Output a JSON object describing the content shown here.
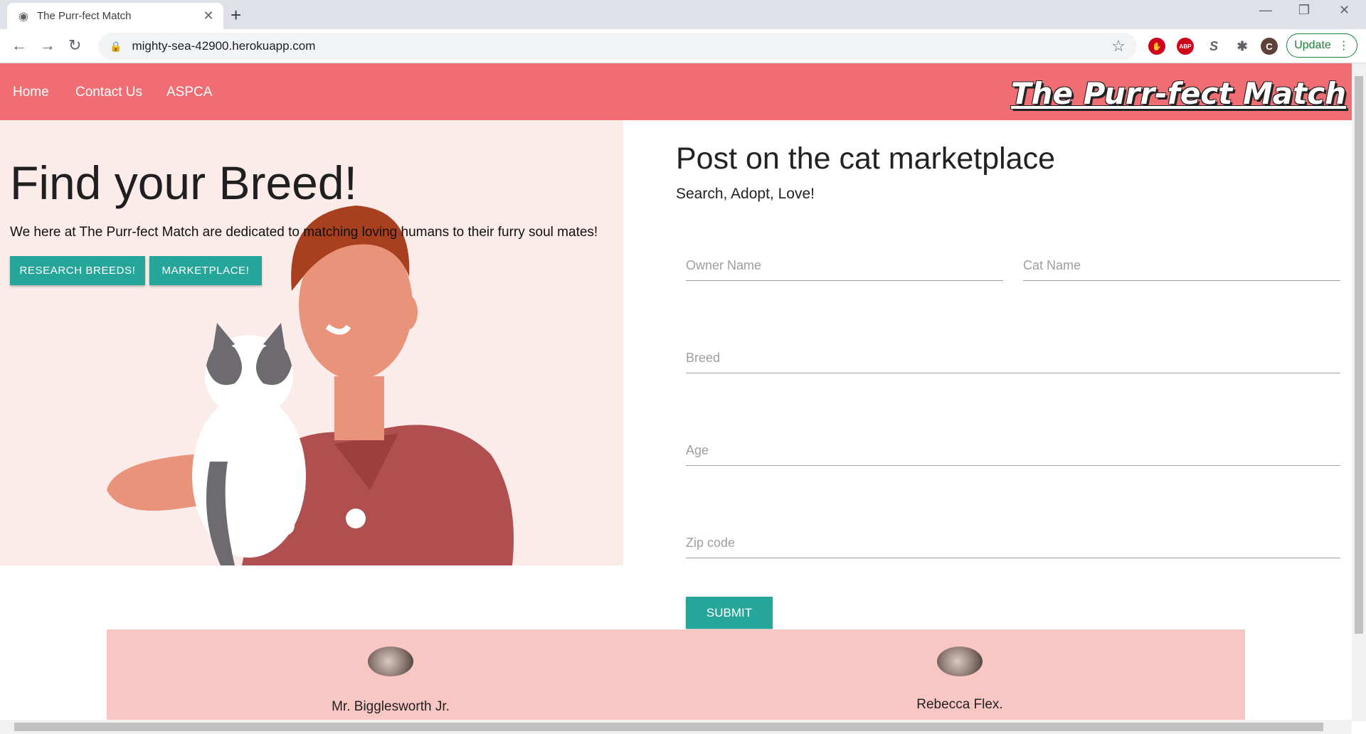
{
  "browser": {
    "tab_title": "The Purr-fect Match",
    "url": "mighty-sea-42900.herokuapp.com",
    "update_label": "Update",
    "profile_initial": "C"
  },
  "site": {
    "nav": [
      "Home",
      "Contact Us",
      "ASPCA"
    ],
    "brand": "The Purr-fect Match"
  },
  "hero": {
    "title": "Find your Breed!",
    "text": "We here at The Purr-fect Match are dedicated to matching loving humans to their furry soul mates!",
    "buttons": [
      "RESEARCH BREEDS!",
      "MARKETPLACE!"
    ]
  },
  "form": {
    "title": "Post on the cat marketplace",
    "subtitle": "Search, Adopt, Love!",
    "fields": [
      "Owner Name",
      "Cat Name",
      "Breed",
      "Age",
      "Zip code"
    ],
    "submit": "SUBMIT"
  },
  "cats": [
    "Mr. Bigglesworth Jr.",
    "Rebecca Flex."
  ],
  "colors": {
    "nav": "#ef6d73",
    "accent": "#26a69a",
    "hero_bg": "#fbecea",
    "gallery_bg": "#f8c6c3"
  }
}
